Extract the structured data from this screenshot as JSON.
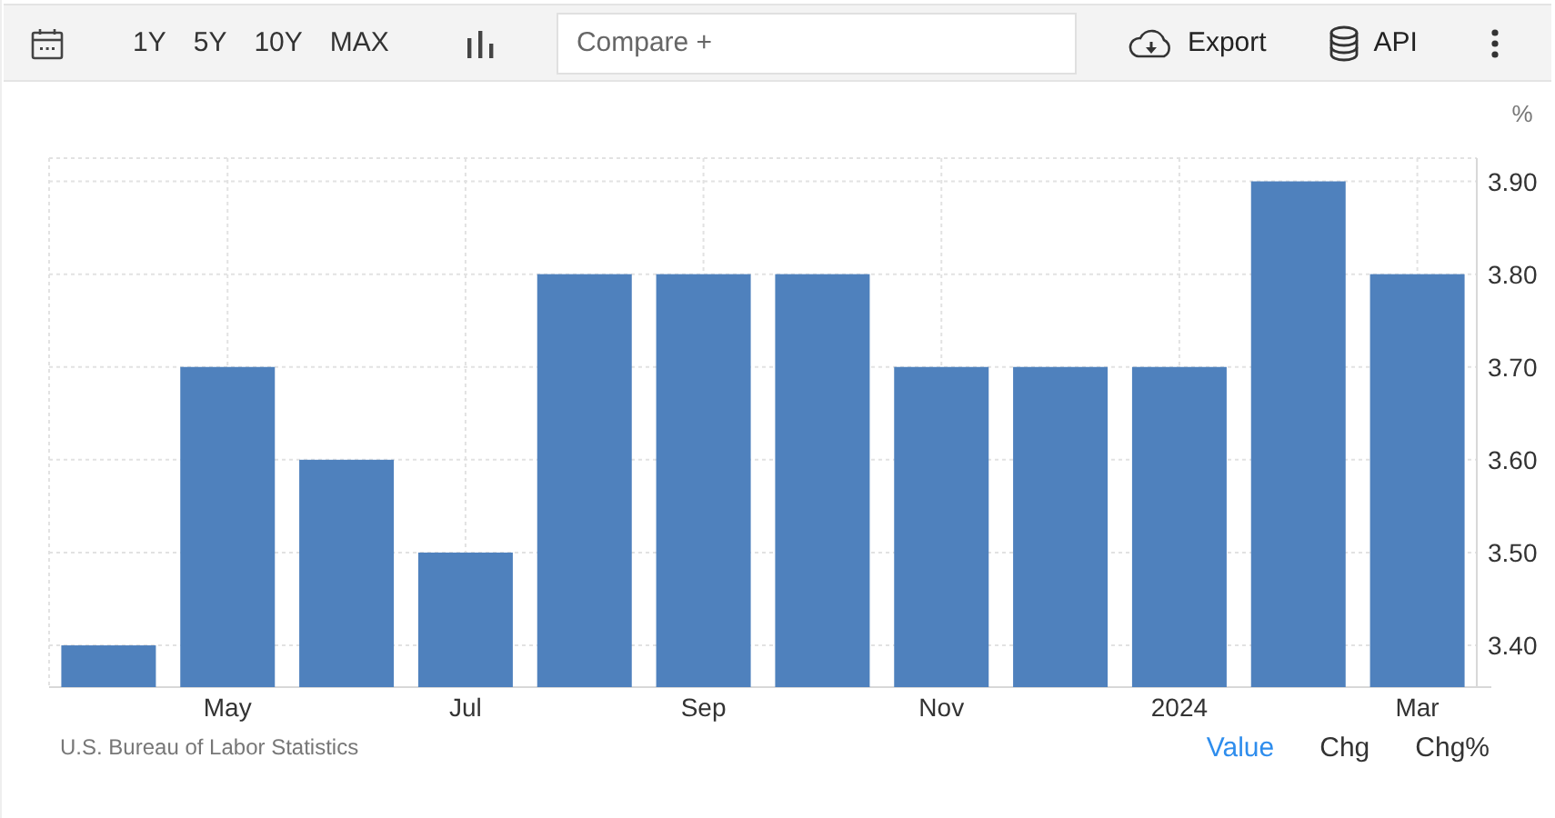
{
  "toolbar": {
    "ranges": [
      {
        "label": "1Y"
      },
      {
        "label": "5Y"
      },
      {
        "label": "10Y"
      },
      {
        "label": "MAX"
      }
    ],
    "compare": {
      "placeholder": "Compare +"
    },
    "export": {
      "label": "Export"
    },
    "api": {
      "label": "API"
    }
  },
  "chart": {
    "unit": "%",
    "chart_data": {
      "type": "bar",
      "grid": true,
      "categories": [
        null,
        "May",
        null,
        "Jul",
        null,
        "Sep",
        null,
        "Nov",
        null,
        "2024",
        null,
        "Mar"
      ],
      "series": [
        {
          "color": "#4f81bd",
          "values": [
            3.4,
            3.7,
            3.6,
            3.5,
            3.8,
            3.8,
            3.8,
            3.7,
            3.7,
            3.7,
            3.9,
            3.8
          ]
        }
      ],
      "ylim": [
        3.355,
        3.925
      ],
      "yticks": [
        {
          "value": 3.4,
          "label": "3.40"
        },
        {
          "value": 3.5,
          "label": "3.50"
        },
        {
          "value": 3.6,
          "label": "3.60"
        },
        {
          "value": 3.7,
          "label": "3.70"
        },
        {
          "value": 3.8,
          "label": "3.80"
        },
        {
          "value": 3.9,
          "label": "3.90"
        }
      ]
    }
  },
  "footer": {
    "source": "U.S. Bureau of Labor Statistics",
    "views": [
      {
        "label": "Value",
        "selected": true
      },
      {
        "label": "Chg",
        "selected": false
      },
      {
        "label": "Chg%",
        "selected": false
      }
    ]
  }
}
